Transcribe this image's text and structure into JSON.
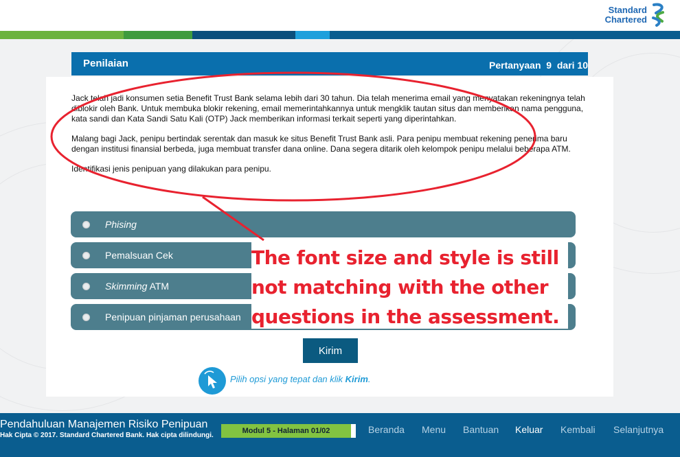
{
  "brand": {
    "line1": "Standard",
    "line2": "Chartered"
  },
  "colors": {
    "accent": "#0a6fad",
    "option_bg": "#4d7e8d",
    "annotation": "#e8222f",
    "green": "#82c341"
  },
  "header": {
    "title": "Penilaian",
    "question_counter": "Pertanyaan  9  dari 10"
  },
  "question": {
    "paragraph1": "Jack telah jadi konsumen setia Benefit Trust Bank selama lebih dari 30 tahun.  Dia telah menerima email yang menyatakan rekeningnya telah diblokir oleh Bank. Untuk membuka blokir rekening, email memerintahkannya untuk mengklik tautan situs dan memberikan nama pengguna, kata sandi dan Kata Sandi Satu Kali (OTP) Jack memberikan informasi terkait seperti yang diperintahkan.",
    "paragraph2": "Malang bagi Jack, penipu bertindak serentak dan masuk ke situs Benefit Trust Bank asli. Para penipu membuat rekening penerima baru dengan institusi finansial berbeda, juga membuat transfer dana online. Dana segera ditarik oleh kelompok penipu melalui beberapa ATM.",
    "prompt": "Identifikasi jenis penipuan yang dilakukan para penipu."
  },
  "options": [
    {
      "label": "Phising"
    },
    {
      "label": "Pemalsuan Cek"
    },
    {
      "label_italic": "Skimming",
      "label_rest": " ATM"
    },
    {
      "label": "Penipuan pinjaman perusahaan"
    }
  ],
  "submit_label": "Kirim",
  "hint": {
    "before": "Pilih opsi yang tepat dan klik ",
    "bold": "Kirim",
    "after": "."
  },
  "annotation": {
    "line1": "The font size and style is still",
    "line2": "not matching with the other",
    "line3": "questions in the assessment."
  },
  "footer": {
    "course_title": "Pendahuluan Manajemen Risiko Penipuan",
    "copyright": "Hak Cipta © 2017. Standard Chartered Bank. Hak cipta dilindungi.",
    "module": "Modul 5 - Halaman 01/02",
    "nav": {
      "home": "Beranda",
      "menu": "Menu",
      "help": "Bantuan",
      "exit": "Keluar",
      "back": "Kembali",
      "next": "Selanjutnya"
    }
  }
}
